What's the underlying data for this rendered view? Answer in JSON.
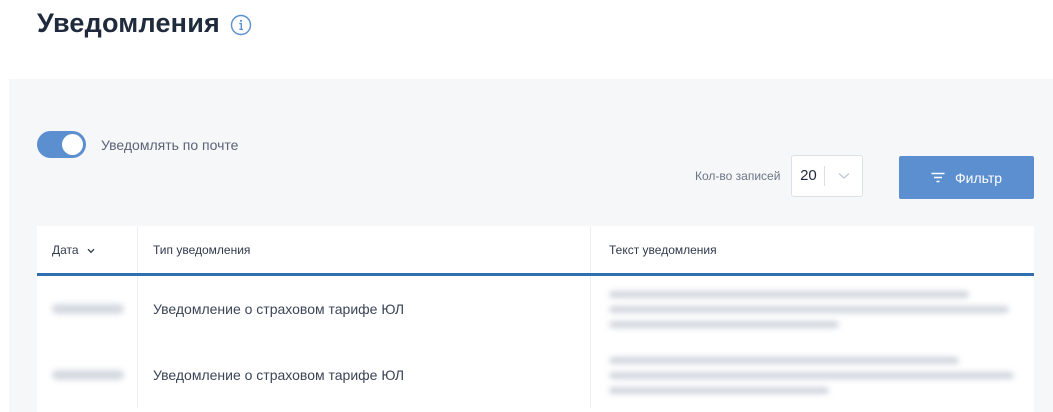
{
  "page": {
    "title": "Уведомления",
    "info_icon": "info-icon"
  },
  "notifications_toggle": {
    "label": "Уведомлять по почте",
    "enabled": true
  },
  "records": {
    "label": "Кол-во записей",
    "value": "20"
  },
  "filter_button": {
    "label": "Фильтр",
    "icon": "filter-icon"
  },
  "table": {
    "columns": [
      "Дата",
      "Тип уведомления",
      "Текст уведомления"
    ],
    "sort_icon": "chevron-down-icon",
    "rows": [
      {
        "type": "Уведомление о страховом тарифе ЮЛ"
      },
      {
        "type": "Уведомление о страховом тарифе ЮЛ"
      }
    ]
  },
  "colors": {
    "accent": "#5b8fd0",
    "table_rule": "#2f6fb0",
    "panel_bg": "#f6f7f9"
  }
}
